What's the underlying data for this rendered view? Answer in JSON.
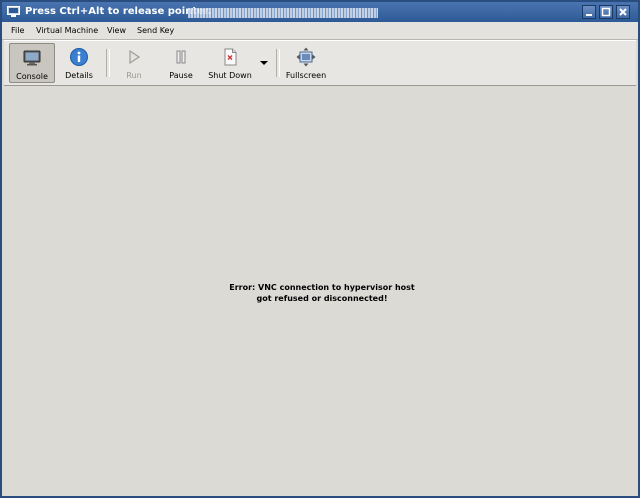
{
  "window": {
    "title": "Press Ctrl+Alt to release pointer."
  },
  "menu": {
    "items": [
      "File",
      "Virtual Machine",
      "View",
      "Send Key"
    ]
  },
  "toolbar": {
    "console_label": "Console",
    "details_label": "Details",
    "run_label": "Run",
    "pause_label": "Pause",
    "shutdown_label": "Shut Down",
    "fullscreen_label": "Fullscreen"
  },
  "content": {
    "error_line1": "Error: VNC connection to hypervisor host",
    "error_line2": "got refused or disconnected!"
  },
  "colors": {
    "titlebar": "#2d5a96",
    "window_bg": "#dcdad5",
    "info_icon": "#3a7fd0",
    "shutdown_mark": "#d03030"
  }
}
